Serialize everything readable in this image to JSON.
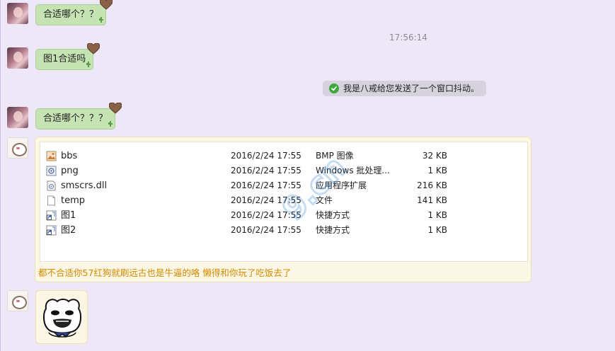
{
  "chat": {
    "messages": [
      {
        "sender": "girl",
        "text": "合适哪个？？"
      },
      {
        "sender": "girl",
        "text": "图1合适吗"
      },
      {
        "sender": "girl",
        "text": "合适哪个？？？"
      }
    ],
    "timestamp": "17:56:14",
    "system_notice": "我是八戒给您发送了一个窗口抖动。",
    "file_message": {
      "files": [
        {
          "icon": "bmp-image-icon",
          "name": "bbs",
          "date": "2016/2/24 17:55",
          "type": "BMP 图像",
          "size": "32 KB"
        },
        {
          "icon": "png-file-icon",
          "name": "png",
          "date": "2016/2/24 17:55",
          "type": "Windows 批处理...",
          "size": "1 KB"
        },
        {
          "icon": "dll-file-icon",
          "name": "smscrs.dll",
          "date": "2016/2/24 17:55",
          "type": "应用程序扩展",
          "size": "216 KB"
        },
        {
          "icon": "blank-file-icon",
          "name": "temp",
          "date": "2016/2/24 17:55",
          "type": "文件",
          "size": "141 KB"
        },
        {
          "icon": "shortcut-icon",
          "name": "图1",
          "date": "2016/2/24 17:55",
          "type": "快捷方式",
          "size": "1 KB"
        },
        {
          "icon": "shortcut-icon",
          "name": "图2",
          "date": "2016/2/24 17:55",
          "type": "快捷方式",
          "size": "1 KB"
        }
      ],
      "caption": "都不合适你57红狗就刷远古也是牛逼的咯 懒得和你玩了吃饭去了"
    },
    "watermark_text": "9.cn"
  },
  "colors": {
    "background": "#ede7f7",
    "bubble_green": "#c6e4b3",
    "notice_bg": "#d7d3de",
    "caption_orange": "#d58a00",
    "check_green": "#3aa83a"
  }
}
